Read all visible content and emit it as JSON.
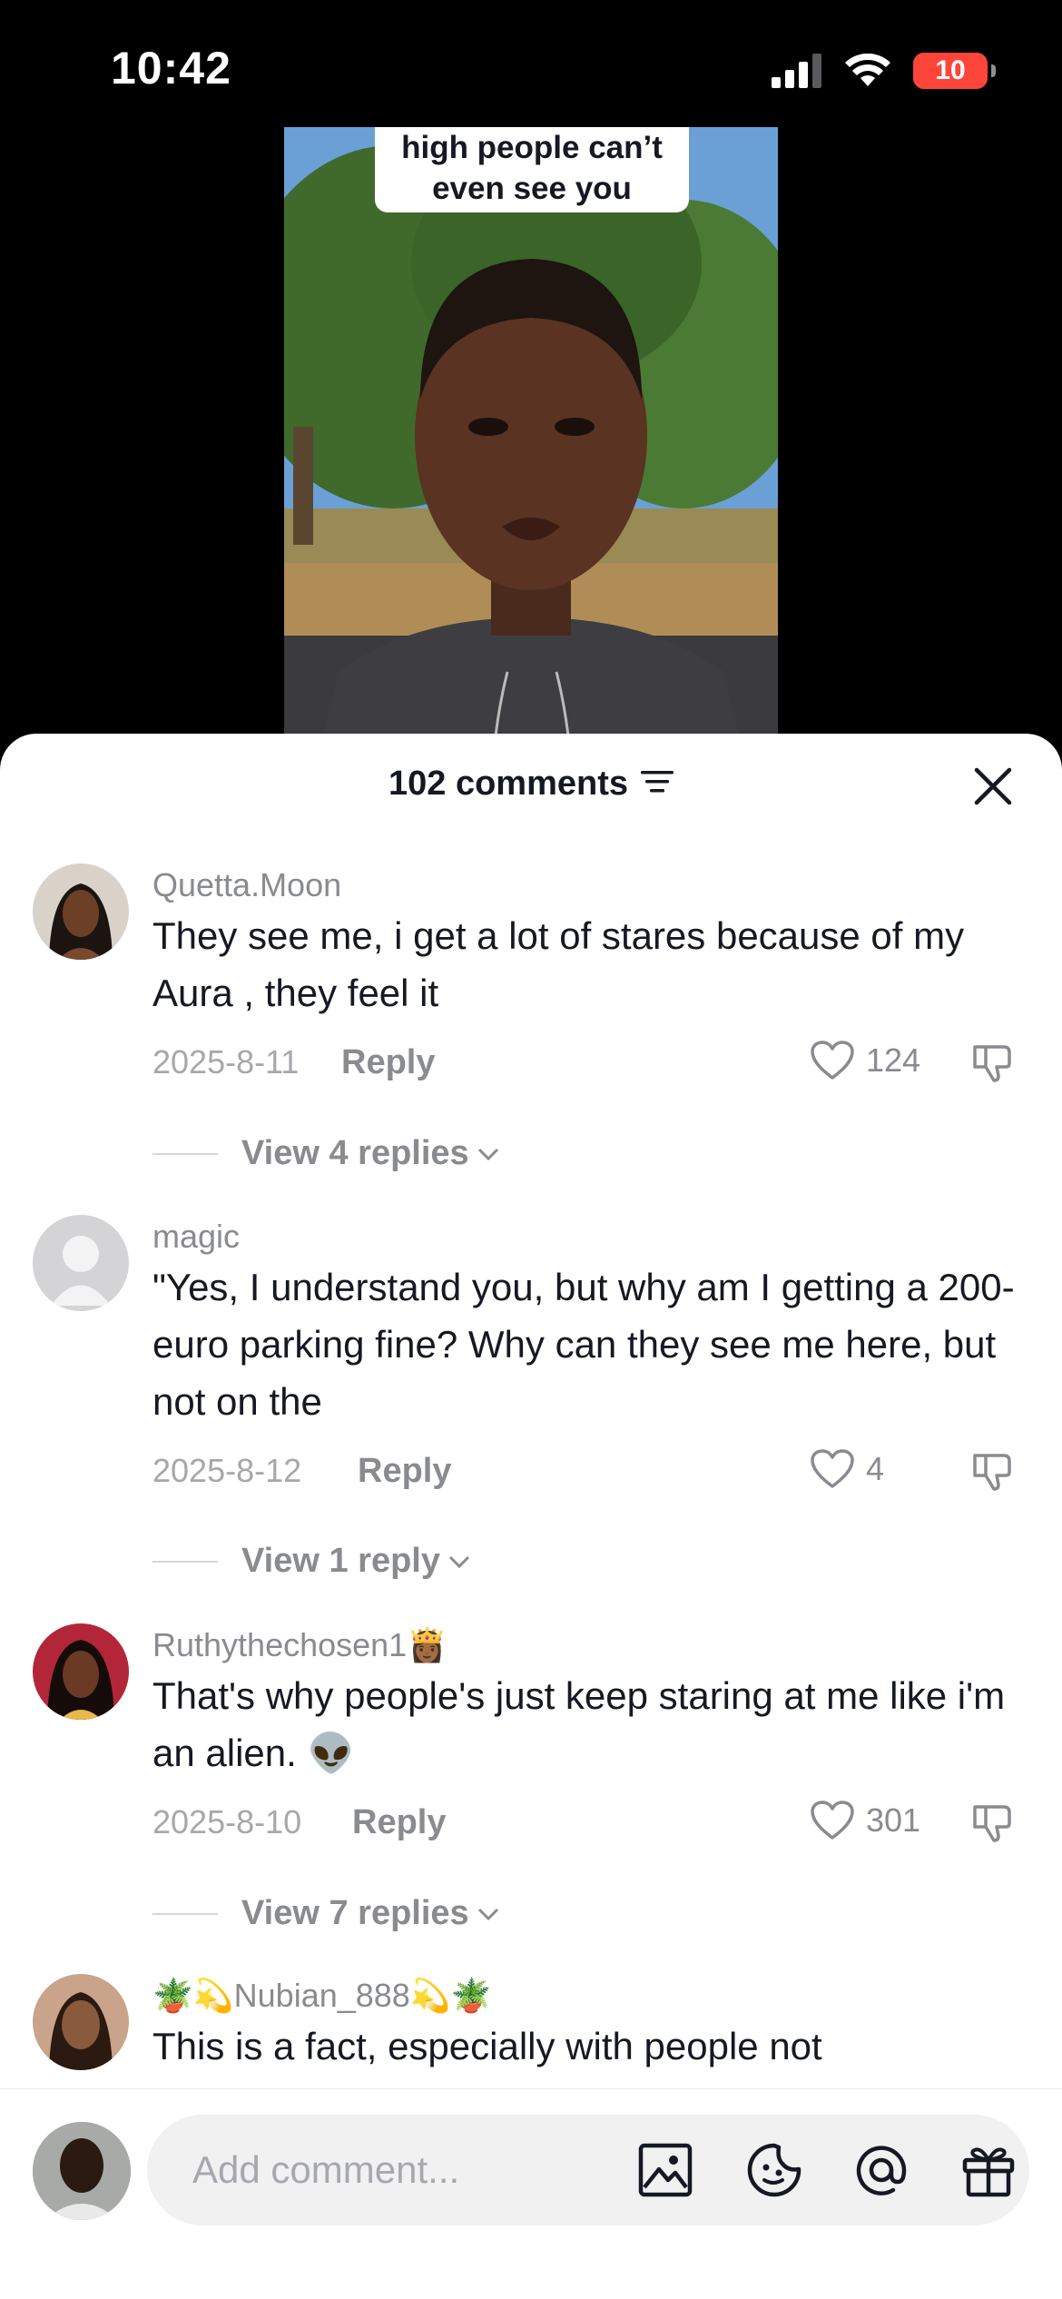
{
  "status_bar": {
    "time": "10:42",
    "battery": "10"
  },
  "video": {
    "caption": "high people can’t even see you"
  },
  "sheet": {
    "comment_count": "102 comments"
  },
  "comments": [
    {
      "user": "Quetta.Moon",
      "text": "They see me, i get a lot of stares because of my Aura , they feel it",
      "date": "2025-8-11",
      "reply": "Reply",
      "likes": "124",
      "view_replies": "View 4 replies"
    },
    {
      "user": "magic",
      "text": "\"Yes, I understand you, but why am I getting a 200-euro parking fine? Why can they see me here, but not on the",
      "date": "2025-8-12",
      "reply": "Reply",
      "likes": "4",
      "view_replies": "View 1 reply"
    },
    {
      "user": "Ruthythechosen1",
      "user_emoji": "👸🏾",
      "text": "That's why people's just keep staring at me like i'm an alien. 👽",
      "date": "2025-8-10",
      "reply": "Reply",
      "likes": "301",
      "view_replies": "View 7 replies"
    },
    {
      "user": "Nubian_888",
      "user_emoji_left": "🪴💫",
      "user_emoji_right": "💫🪴",
      "text": "This is a fact, especially with people not"
    }
  ],
  "composer": {
    "placeholder": "Add comment..."
  }
}
